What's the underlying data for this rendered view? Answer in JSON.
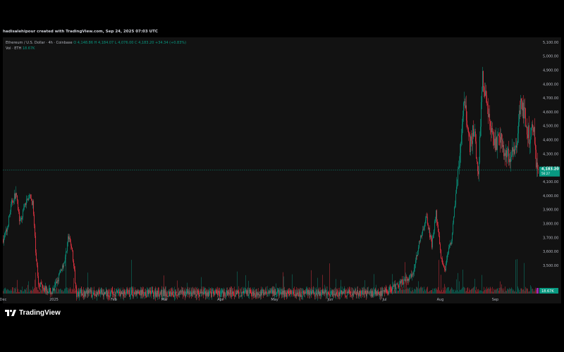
{
  "header": {
    "attribution": "hadisalehipour created with TradingView.com, Sep 24, 2025 07:03 UTC"
  },
  "legend": {
    "symbol": "Ethereum / U.S. Dollar · 4h · Coinbase",
    "open": "O 4,148.86",
    "high": "H 4,184.07",
    "low": "L 4,076.00",
    "close": "C 4,183.20",
    "change": "+34.34 (+0.83%)",
    "volume_label": "Vol · ETH",
    "volume_value": "18.67K"
  },
  "price_tag": {
    "price": "4,183.20",
    "countdown": "56:27",
    "volume": "18.67K"
  },
  "footer": {
    "brand": "TradingView"
  },
  "colors": {
    "up": "#089981",
    "down": "#f23645",
    "axis_text": "#b2b5be",
    "background": "#121212",
    "page": "#000000"
  },
  "chart_data": {
    "type": "candlestick",
    "title": "Ethereum / U.S. Dollar · 4h · Coinbase",
    "xlabel": "",
    "ylabel": "",
    "ylim": [
      3400,
      5100
    ],
    "y_ticks": [
      "5,100.00",
      "5,000.00",
      "4,900.00",
      "4,800.00",
      "4,700.00",
      "4,600.00",
      "4,500.00",
      "4,400.00",
      "4,300.00",
      "4,200.00",
      "4,100.00",
      "4,000.00",
      "3,900.00",
      "3,800.00",
      "3,700.00",
      "3,600.00",
      "3,500.00"
    ],
    "y_tick_values": [
      5100,
      5000,
      4900,
      4800,
      4700,
      4600,
      4500,
      4400,
      4300,
      4200,
      4100,
      4000,
      3900,
      3800,
      3700,
      3600,
      3500
    ],
    "x_ticks": [
      {
        "label": "Dec",
        "index": 0
      },
      {
        "label": "2025",
        "index": 72
      },
      {
        "label": "Feb",
        "index": 157
      },
      {
        "label": "Mar",
        "index": 229
      },
      {
        "label": "Apr",
        "index": 308
      },
      {
        "label": "May",
        "index": 385
      },
      {
        "label": "Jun",
        "index": 464
      },
      {
        "label": "Jul",
        "index": 541
      },
      {
        "label": "Aug",
        "index": 620
      },
      {
        "label": "Sep",
        "index": 698
      }
    ],
    "n_slots": 760,
    "price_path": [
      {
        "i": 0,
        "p": 3690
      },
      {
        "i": 5,
        "p": 3750
      },
      {
        "i": 12,
        "p": 3950
      },
      {
        "i": 18,
        "p": 4020
      },
      {
        "i": 24,
        "p": 3800
      },
      {
        "i": 30,
        "p": 3920
      },
      {
        "i": 36,
        "p": 4000
      },
      {
        "i": 42,
        "p": 3950
      },
      {
        "i": 46,
        "p": 3600
      },
      {
        "i": 50,
        "p": 3380
      },
      {
        "i": 70,
        "p": 3300
      },
      {
        "i": 88,
        "p": 3550
      },
      {
        "i": 92,
        "p": 3700
      },
      {
        "i": 97,
        "p": 3640
      },
      {
        "i": 104,
        "p": 3300
      },
      {
        "i": 540,
        "p": 3300
      },
      {
        "i": 580,
        "p": 3430
      },
      {
        "i": 592,
        "p": 3700
      },
      {
        "i": 600,
        "p": 3850
      },
      {
        "i": 608,
        "p": 3650
      },
      {
        "i": 614,
        "p": 3880
      },
      {
        "i": 620,
        "p": 3600
      },
      {
        "i": 626,
        "p": 3460
      },
      {
        "i": 636,
        "p": 3700
      },
      {
        "i": 642,
        "p": 4000
      },
      {
        "i": 648,
        "p": 4280
      },
      {
        "i": 654,
        "p": 4700
      },
      {
        "i": 662,
        "p": 4350
      },
      {
        "i": 668,
        "p": 4500
      },
      {
        "i": 674,
        "p": 4150
      },
      {
        "i": 680,
        "p": 4850
      },
      {
        "i": 686,
        "p": 4650
      },
      {
        "i": 692,
        "p": 4450
      },
      {
        "i": 698,
        "p": 4350
      },
      {
        "i": 706,
        "p": 4450
      },
      {
        "i": 712,
        "p": 4280
      },
      {
        "i": 720,
        "p": 4300
      },
      {
        "i": 728,
        "p": 4350
      },
      {
        "i": 734,
        "p": 4680
      },
      {
        "i": 740,
        "p": 4570
      },
      {
        "i": 746,
        "p": 4420
      },
      {
        "i": 752,
        "p": 4500
      },
      {
        "i": 756,
        "p": 4250
      },
      {
        "i": 759,
        "p": 4183
      }
    ],
    "last_price": 4183.2,
    "grid": false
  }
}
